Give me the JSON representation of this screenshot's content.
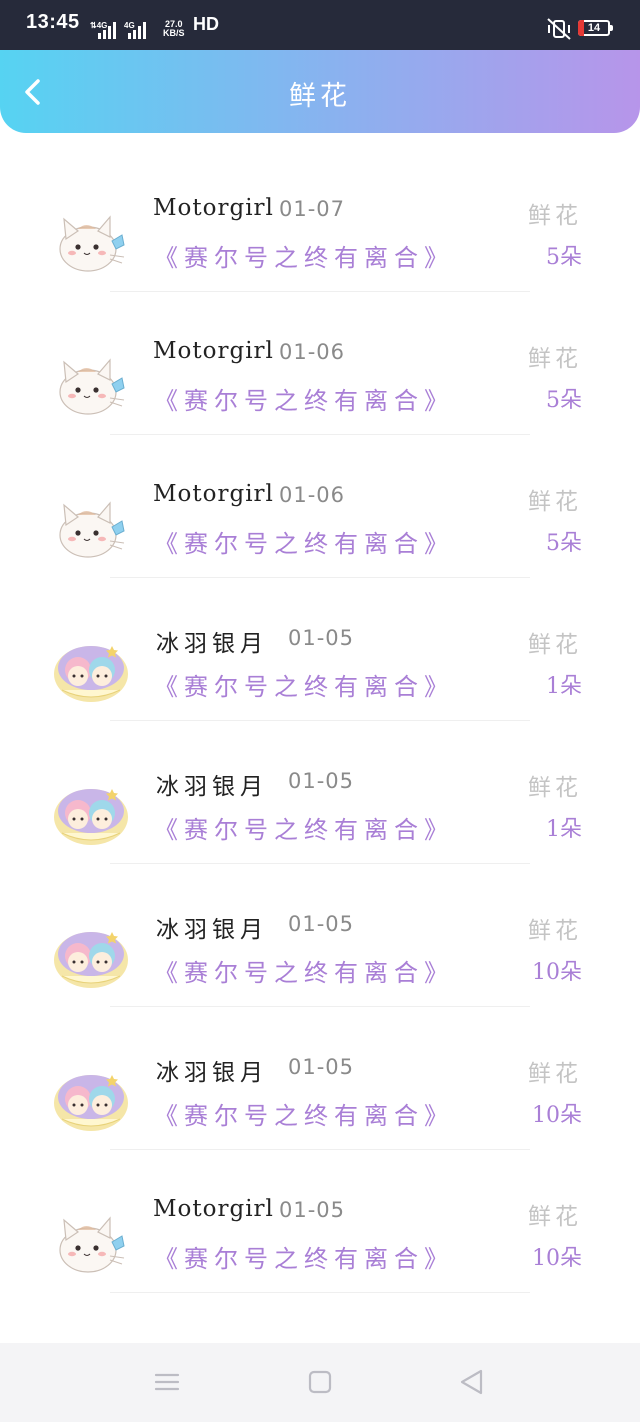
{
  "status_bar": {
    "time": "13:45",
    "network_speed_value": "27.0",
    "network_speed_unit": "KB/S",
    "hd": "HD",
    "battery": "14"
  },
  "header": {
    "title": "鲜花"
  },
  "items": [
    {
      "name": "Motorgirl",
      "date": "01-07",
      "book": "《赛尔号之终有离合》",
      "gift_label": "鲜花",
      "count": "5朵",
      "avatar": "cat"
    },
    {
      "name": "Motorgirl",
      "date": "01-06",
      "book": "《赛尔号之终有离合》",
      "gift_label": "鲜花",
      "count": "5朵",
      "avatar": "cat"
    },
    {
      "name": "Motorgirl",
      "date": "01-06",
      "book": "《赛尔号之终有离合》",
      "gift_label": "鲜花",
      "count": "5朵",
      "avatar": "cat"
    },
    {
      "name": "冰羽银月",
      "date": "01-05",
      "book": "《赛尔号之终有离合》",
      "gift_label": "鲜花",
      "count": "1朵",
      "avatar": "twins"
    },
    {
      "name": "冰羽银月",
      "date": "01-05",
      "book": "《赛尔号之终有离合》",
      "gift_label": "鲜花",
      "count": "1朵",
      "avatar": "twins"
    },
    {
      "name": "冰羽银月",
      "date": "01-05",
      "book": "《赛尔号之终有离合》",
      "gift_label": "鲜花",
      "count": "10朵",
      "avatar": "twins"
    },
    {
      "name": "冰羽银月",
      "date": "01-05",
      "book": "《赛尔号之终有离合》",
      "gift_label": "鲜花",
      "count": "10朵",
      "avatar": "twins"
    },
    {
      "name": "Motorgirl",
      "date": "01-05",
      "book": "《赛尔号之终有离合》",
      "gift_label": "鲜花",
      "count": "10朵",
      "avatar": "cat"
    }
  ],
  "nav": {
    "icons": [
      "menu-icon",
      "home-icon",
      "back-icon"
    ]
  },
  "colors": {
    "header_start": "#56d3f2",
    "header_end": "#b795ea",
    "accent_purple": "#a97fd6",
    "muted_gray": "#c4c4c4"
  }
}
